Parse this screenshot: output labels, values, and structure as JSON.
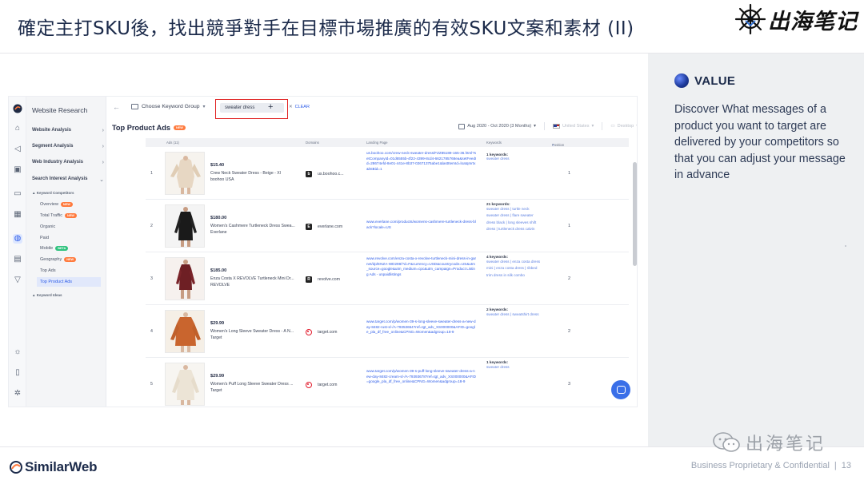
{
  "slide": {
    "title": "確定主打SKU後，找出競爭對手在目標市場推廣的有效SKU文案和素材 (II)",
    "brand_text": "出海笔记"
  },
  "value_panel": {
    "heading": "VALUE",
    "text": "Discover What messages of a product you want to target are delivered by your competitors so that you can adjust your message in advance"
  },
  "footer": {
    "logo_text": "SimilarWeb",
    "confidential": "Business Proprietary & Confidential",
    "page_number": "13",
    "watermark_text": "出海笔记"
  },
  "app": {
    "nav_title": "Website Research",
    "nav_sections": [
      {
        "label": "Website Analysis"
      },
      {
        "label": "Segment Analysis"
      },
      {
        "label": "Web Industry Analysis"
      },
      {
        "label": "Search Interest Analysis"
      }
    ],
    "nav_sub_heading": "Keyword Competitors",
    "nav_items": [
      {
        "label": "Overview",
        "badge": "NEW"
      },
      {
        "label": "Total Traffic",
        "badge": "NEW"
      },
      {
        "label": "Organic",
        "badge": ""
      },
      {
        "label": "Paid",
        "badge": ""
      },
      {
        "label": "Mobile",
        "badge": "BETA"
      },
      {
        "label": "Geography",
        "badge": "NEW"
      },
      {
        "label": "Top Ads",
        "badge": ""
      },
      {
        "label": "Top Product Ads",
        "badge": ""
      }
    ],
    "nav_sub_heading_2": "Keyword Ideas",
    "topbar": {
      "keyword_group_label": "Choose Keyword Group",
      "keyword_chip": "sweater dress",
      "clear_label": "CLEAR"
    },
    "section_title": "Top Product Ads",
    "section_badge": "NEW",
    "filters": {
      "date_range": "Aug 2020 - Oct 2020 (3 Months)",
      "country": "United States",
      "device": "Desktop"
    },
    "table": {
      "headers": {
        "ads": "Ads (11)",
        "domains": "Domains",
        "landing": "Landing Page",
        "keywords": "Keywords",
        "position": "Position"
      },
      "rows": [
        {
          "index": "1",
          "price": "$15.40",
          "name": "Crew Neck Sweater Dress - Beige - Xl",
          "store": "boohoo USA",
          "domain_icon": "b",
          "domain": "us.boohoo.c...",
          "landing": "us.boohoo.com/crew-neck-sweater-dress/FZZ85189-165-36.html?setCompanyId=01d6555b-4f22-4399-8cd4-6621785768ea&setFeedId=28674efd-8e01-441e-8b37-02671375abe1&lastItemId=loatqmrtx&lstBid=1",
          "kw_count": "1 keywords:",
          "keywords": "sweater dress",
          "position": "1"
        },
        {
          "index": "2",
          "price": "$180.00",
          "name": "Women's Cashmere Turtleneck Dress Swea...",
          "store": "Everlane",
          "domain_icon": "E",
          "domain": "everlane.com",
          "landing": "www.everlane.com/products/womens-cashmere-turtleneck-dress-black?locale=US",
          "kw_count": "21 keywords:",
          "keywords": "sweater dress | turtle neck sweater dress | flare sweater dress black | long sleeves shift dress | turtleneck dress calvin",
          "position": "1"
        },
        {
          "index": "3",
          "price": "$185.00",
          "name": "Enza Costa X REVOLVE Turtleneck Mini Dr...",
          "store": "REVOLVE",
          "domain_icon": "R",
          "domain": "revolve.com",
          "landing": "www.revolve.com/enza-costa-x-revolve-turtleneck-mini-dress-in-garnet/dp/ENZA-WD298/?d=F&currency=USD&countrycode=US&utm_source=google&utm_medium=cpc&utm_campaign=Product Listing Ads - unpaidlistings",
          "kw_count": "4 keywords:",
          "keywords": "sweater dress | enza costa dress mini | enza costa dress | ribbed trim dress in silk combo",
          "position": "2"
        },
        {
          "index": "4",
          "price": "$29.99",
          "name": "Women's Long Sleeve Sweater Dress - A N...",
          "store": "Target",
          "domain_icon": "",
          "domain": "target.com",
          "landing": "www.target.com/p/women-39-s-long-sleeve-sweater-dress-a-new-day-8482-rust-s/-/A-79353654?ref=tgt_adv_XS000000&AFID=google_pla_df_free_online&CPNG=Women&adgroup=18-9",
          "kw_count": "2 keywords:",
          "keywords": "sweater dress | sweatshirt dress",
          "position": "2"
        },
        {
          "index": "5",
          "price": "$29.99",
          "name": "Women's Puff Long Sleeve Sweater Dress ...",
          "store": "Target",
          "domain_icon": "",
          "domain": "target.com",
          "landing": "www.target.com/p/women-39-s-puff-long-sleeve-sweater-dress-a-new-day-8482-cream-s/-/A-79393678?ref=tgt_adv_XS000000&AFID=google_pla_df_free_online&CPNG=Women&adgroup=18-9",
          "kw_count": "1 keywords:",
          "keywords": "sweater dress",
          "position": "3"
        }
      ]
    }
  },
  "colors": {
    "accent_blue": "#2d5ce8",
    "highlight_red": "#e02020",
    "value_panel_bg": "#eef0f2"
  }
}
